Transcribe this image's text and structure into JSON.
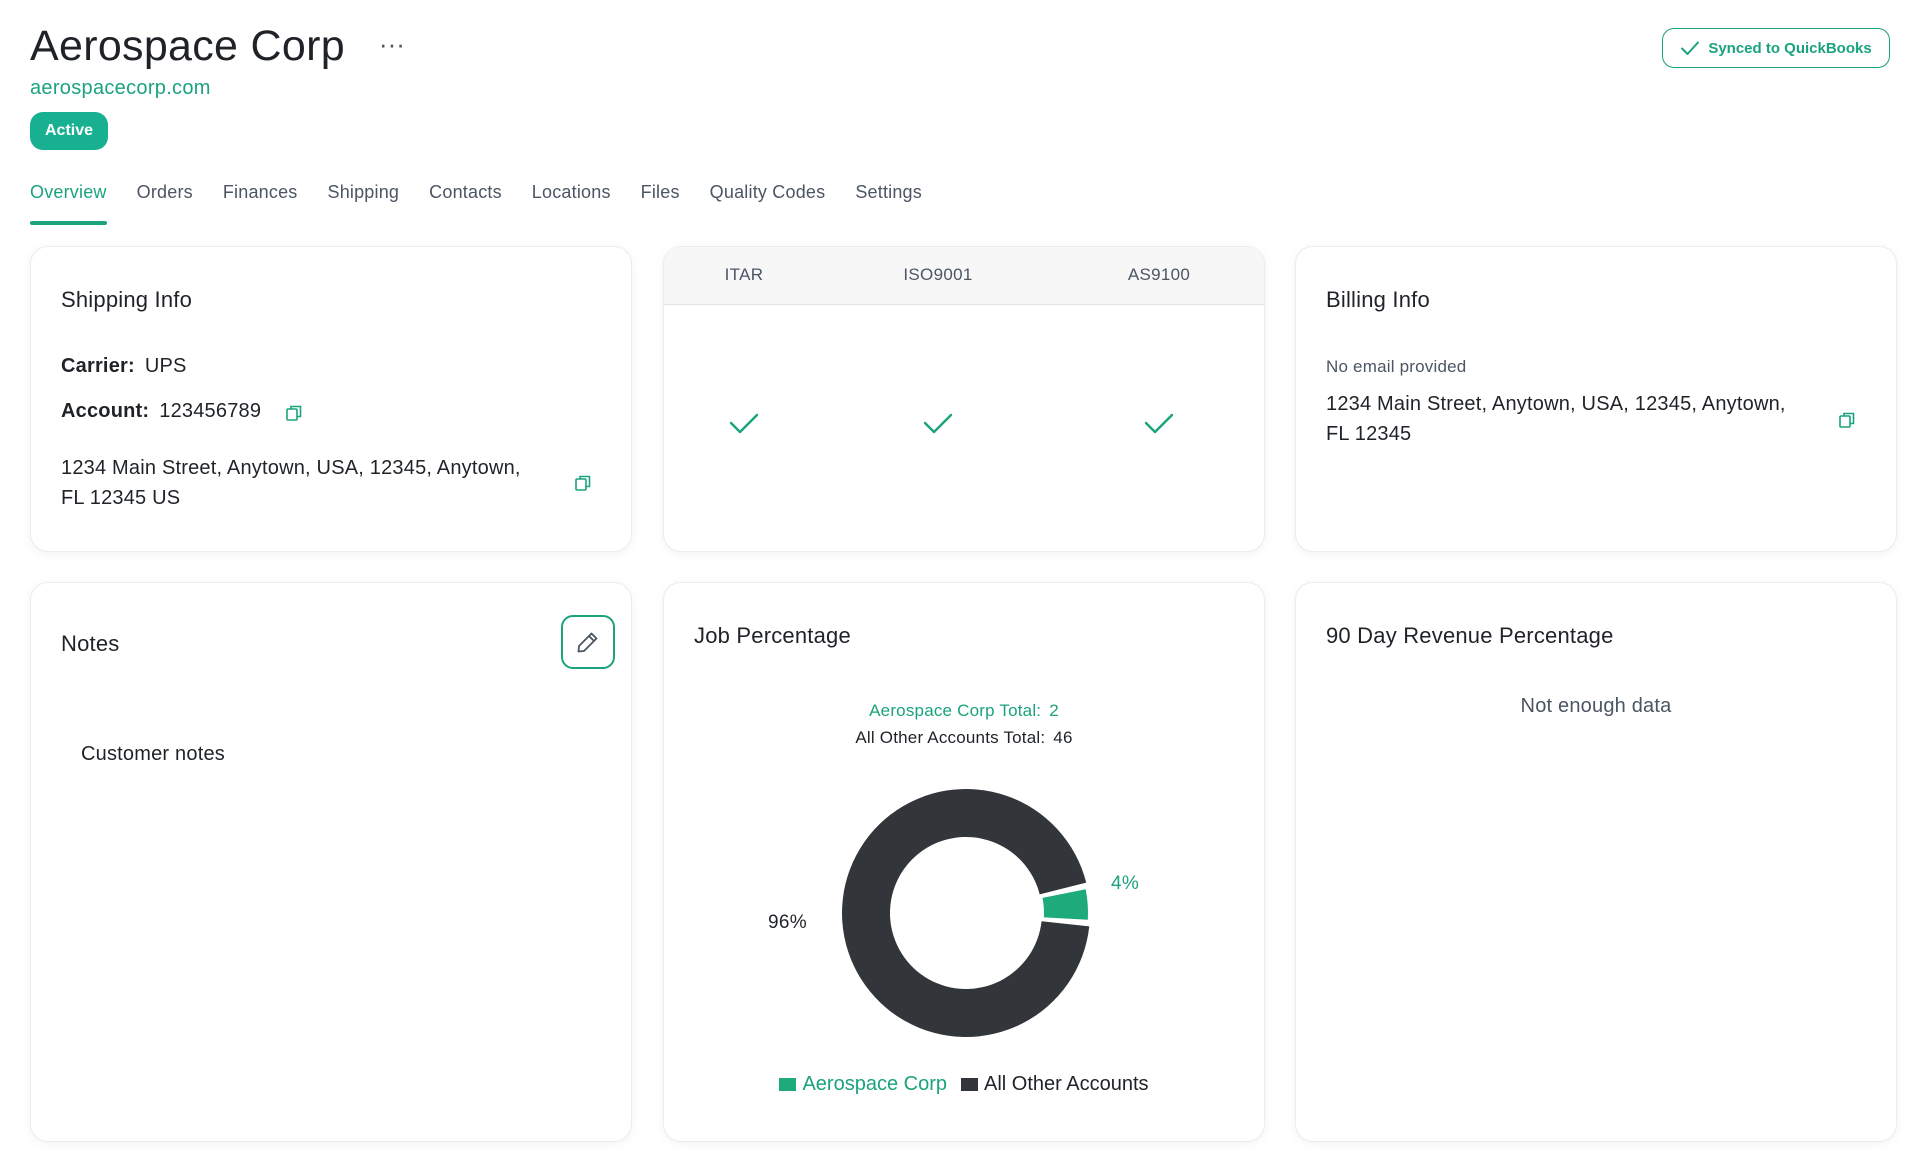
{
  "customer": {
    "name": "Aerospace Corp",
    "more_label": "···",
    "website": "aerospacecorp.com",
    "status": "Active"
  },
  "sync": {
    "label": "Synced to QuickBooks"
  },
  "tabs": [
    {
      "label": "Overview",
      "active": true
    },
    {
      "label": "Orders"
    },
    {
      "label": "Finances"
    },
    {
      "label": "Shipping"
    },
    {
      "label": "Contacts"
    },
    {
      "label": "Locations"
    },
    {
      "label": "Files"
    },
    {
      "label": "Quality Codes"
    },
    {
      "label": "Settings"
    }
  ],
  "shipping_info": {
    "title": "Shipping Info",
    "carrier_label": "Carrier:",
    "carrier": "UPS",
    "account_label": "Account:",
    "account": "123456789",
    "address_line1": "1234 Main Street, Anytown, USA, 12345, Anytown,",
    "address_line2": "FL 12345 US"
  },
  "certifications": {
    "items": [
      {
        "label": "ITAR",
        "checked": true
      },
      {
        "label": "ISO9001",
        "checked": true
      },
      {
        "label": "AS9100",
        "checked": true
      }
    ]
  },
  "billing_info": {
    "title": "Billing Info",
    "email": "No email provided",
    "address_line1": "1234 Main Street, Anytown, USA, 12345, Anytown,",
    "address_line2": "FL 12345"
  },
  "notes": {
    "title": "Notes",
    "text": "Customer notes"
  },
  "job_percentage": {
    "title": "Job Percentage",
    "company_total_label": "Aerospace Corp Total:",
    "company_total": "2",
    "others_total_label": "All Other Accounts Total:",
    "others_total": "46",
    "company_pct_label": "4%",
    "others_pct_label": "96%"
  },
  "revenue": {
    "title": "90 Day Revenue Percentage",
    "empty_message": "Not enough data"
  },
  "chart_data": {
    "type": "pie",
    "categories": [
      "Aerospace Corp",
      "All Other Accounts"
    ],
    "values": [
      4,
      96
    ],
    "colors": [
      "#1faa7b",
      "#32363b"
    ],
    "legend": "bottom"
  },
  "colors": {
    "accent": "#1aa37c",
    "badge": "#17b091",
    "donut_dark": "#32363b"
  }
}
